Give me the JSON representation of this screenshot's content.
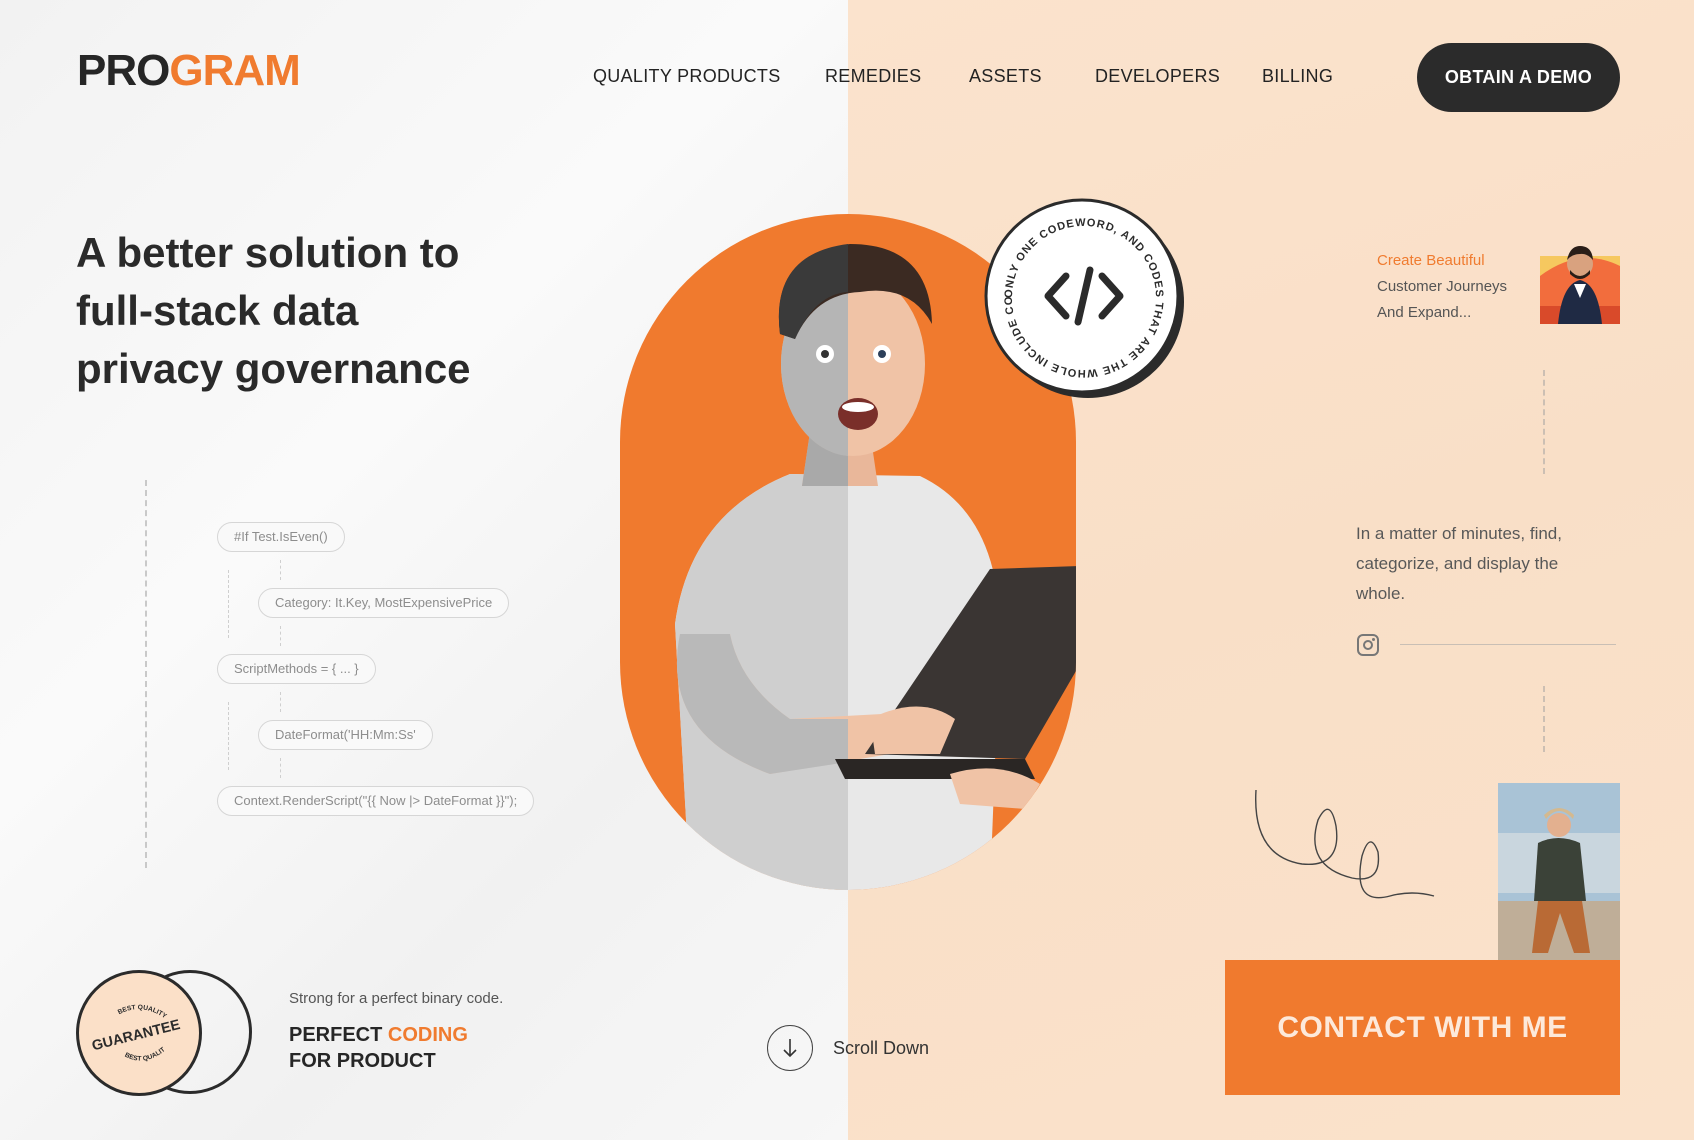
{
  "brand": {
    "logo_part1": "PRO",
    "logo_part2": "GRAM",
    "accent_color": "#f07b2f",
    "dark_color": "#2b2b2b"
  },
  "nav": {
    "items": [
      {
        "label": "QUALITY PRODUCTS"
      },
      {
        "label": "REMEDIES"
      },
      {
        "label": "ASSETS"
      },
      {
        "label": "DEVELOPERS"
      },
      {
        "label": "BILLING"
      }
    ],
    "cta_label": "OBTAIN A DEMO"
  },
  "hero": {
    "title": "A better solution to full-stack data privacy governance"
  },
  "code_flow": {
    "steps": [
      {
        "text": "#If Test.IsEven()"
      },
      {
        "text": "Category: It.Key, MostExpensivePrice"
      },
      {
        "text": "ScriptMethods = { ... }"
      },
      {
        "text": "DateFormat('HH:Mm:Ss'"
      },
      {
        "text": "Context.RenderScript(\"{{ Now |> DateFormat }}\");"
      }
    ]
  },
  "badge": {
    "ring_text": "ONLY ONE CODEWORD, AND CODES THAT ARE THE WHOLE INCLUDE CODES THAT HAVE",
    "icon": "code-icon"
  },
  "journey": {
    "line1": "Create Beautiful",
    "line2": "Customer Journeys",
    "line3": "And Expand..."
  },
  "description": {
    "text": "In a matter of minutes, find, categorize, and display the whole.",
    "social_icon": "instagram-icon"
  },
  "contact": {
    "label": "CONTACT WITH ME"
  },
  "guarantee": {
    "top_text": "BEST QUALITY",
    "main_text": "GUARANTEE",
    "bottom_text": "BEST QUALITY"
  },
  "tagline": {
    "small": "Strong for a perfect binary code.",
    "line1_dark": "PERFECT",
    "line1_accent": "CODING",
    "line2": "FOR PRODUCT"
  },
  "scroll": {
    "label": "Scroll Down",
    "icon": "arrow-down-icon"
  }
}
